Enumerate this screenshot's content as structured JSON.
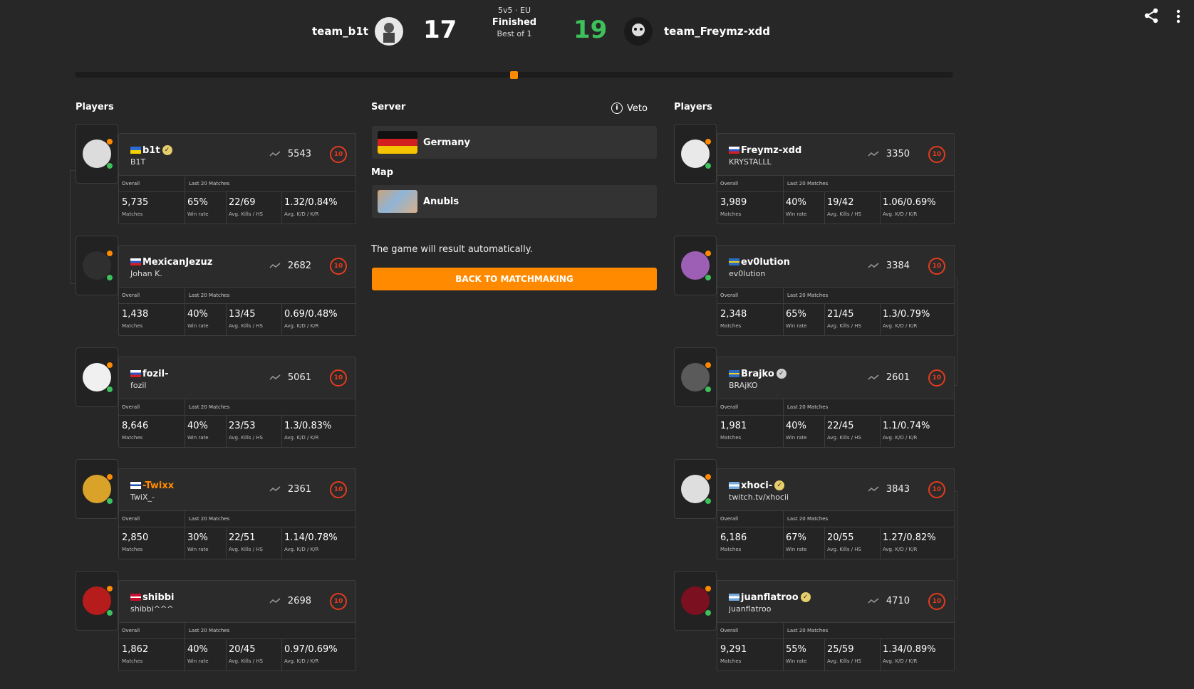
{
  "header": {
    "team1": {
      "name": "team_b1t",
      "score": "17"
    },
    "team2": {
      "name": "team_Freymz-xdd",
      "score": "19",
      "score_color": "#3ec15b"
    },
    "match": {
      "mode": "5v5 · EU",
      "status": "Finished",
      "format": "Best of 1"
    },
    "share_icon": "share-icon",
    "menu_icon": "more-vertical-icon"
  },
  "left_players_label": "Players",
  "right_players_label": "Players",
  "center": {
    "server_label": "Server",
    "veto_label": "Veto",
    "server_name": "Germany",
    "map_label": "Map",
    "map_name": "Anubis",
    "result_text": "The game will result automatically.",
    "back_button": "BACK TO MATCHMAKING"
  },
  "stat_headers": {
    "overall": "Overall",
    "last20": "Last 20 Matches"
  },
  "stat_labels": {
    "matches": "Matches",
    "winrate": "Win rate",
    "kills": "Avg. Kills / HS",
    "kd": "Avg. K/D / K/R"
  },
  "accent": "#ff8a00",
  "team1_players": [
    {
      "nick": "b1t",
      "name": "B1T",
      "elo": "5543",
      "level": "10",
      "matches": "5,735",
      "winrate": "65%",
      "kills": "22/69",
      "kd": "1.32/0.84%",
      "flag": "ua",
      "verified": "gold"
    },
    {
      "nick": "MexicanJezuz",
      "name": "Johan K.",
      "elo": "2682",
      "level": "10",
      "matches": "1,438",
      "winrate": "40%",
      "kills": "13/45",
      "kd": "0.69/0.48%",
      "flag": "ru",
      "verified": ""
    },
    {
      "nick": "fozil-",
      "name": "fozil",
      "elo": "5061",
      "level": "10",
      "matches": "8,646",
      "winrate": "40%",
      "kills": "23/53",
      "kd": "1.3/0.83%",
      "flag": "ru",
      "verified": ""
    },
    {
      "nick": "-Twixx",
      "name": "TwiX_-",
      "elo": "2361",
      "level": "10",
      "matches": "2,850",
      "winrate": "30%",
      "kills": "22/51",
      "kd": "1.14/0.78%",
      "flag": "fi",
      "verified": "",
      "nick_color": "#ff8a00"
    },
    {
      "nick": "shibbi",
      "name": "shibbi^^^",
      "elo": "2698",
      "level": "10",
      "matches": "1,862",
      "winrate": "40%",
      "kills": "20/45",
      "kd": "0.97/0.69%",
      "flag": "dk",
      "verified": ""
    }
  ],
  "team2_players": [
    {
      "nick": "Freymz-xdd",
      "name": "KRYSTALLL",
      "elo": "3350",
      "level": "10",
      "matches": "3,989",
      "winrate": "40%",
      "kills": "19/42",
      "kd": "1.06/0.69%",
      "flag": "ru",
      "verified": ""
    },
    {
      "nick": "ev0lution",
      "name": "ev0lution",
      "elo": "3384",
      "level": "10",
      "matches": "2,348",
      "winrate": "65%",
      "kills": "21/45",
      "kd": "1.3/0.79%",
      "flag": "se",
      "verified": ""
    },
    {
      "nick": "Brajko",
      "name": "BRAjKO",
      "elo": "2601",
      "level": "10",
      "matches": "1,981",
      "winrate": "40%",
      "kills": "22/45",
      "kd": "1.1/0.74%",
      "flag": "se",
      "verified": "grey"
    },
    {
      "nick": "xhoci-",
      "name": "twitch.tv/xhocii",
      "elo": "3843",
      "level": "10",
      "matches": "6,186",
      "winrate": "67%",
      "kills": "20/55",
      "kd": "1.27/0.82%",
      "flag": "ar",
      "verified": "gold"
    },
    {
      "nick": "juanflatroo",
      "name": "juanflatroo",
      "elo": "4710",
      "level": "10",
      "matches": "9,291",
      "winrate": "55%",
      "kills": "25/59",
      "kd": "1.34/0.89%",
      "flag": "ar",
      "verified": "gold"
    }
  ]
}
